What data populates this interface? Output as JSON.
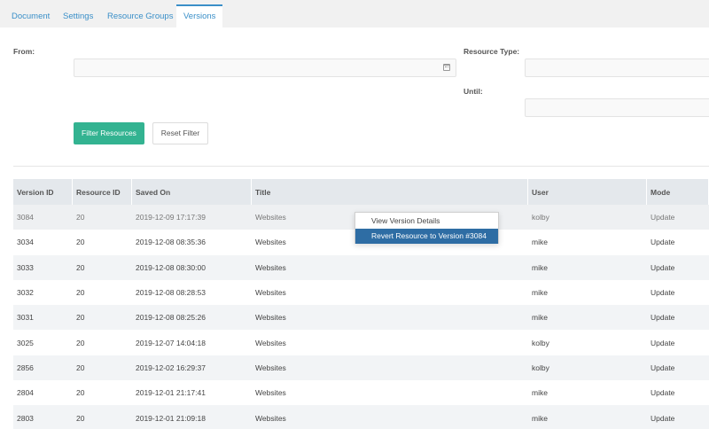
{
  "tabs": [
    {
      "label": "Document"
    },
    {
      "label": "Settings"
    },
    {
      "label": "Resource Groups"
    },
    {
      "label": "Versions"
    }
  ],
  "filter": {
    "from_label": "From:",
    "resource_type_label": "Resource Type:",
    "until_label": "Until:",
    "from_value": "",
    "resource_type_value": "",
    "until_value": "",
    "filter_button": "Filter Resources",
    "reset_button": "Reset Filter"
  },
  "grid": {
    "columns": [
      "Version ID",
      "Resource ID",
      "Saved On",
      "Title",
      "User",
      "Mode"
    ],
    "rows": [
      [
        "3084",
        "20",
        "2019-12-09 17:17:39",
        "Websites",
        "kolby",
        "Update"
      ],
      [
        "3034",
        "20",
        "2019-12-08 08:35:36",
        "Websites",
        "mike",
        "Update"
      ],
      [
        "3033",
        "20",
        "2019-12-08 08:30:00",
        "Websites",
        "mike",
        "Update"
      ],
      [
        "3032",
        "20",
        "2019-12-08 08:28:53",
        "Websites",
        "mike",
        "Update"
      ],
      [
        "3031",
        "20",
        "2019-12-08 08:25:26",
        "Websites",
        "mike",
        "Update"
      ],
      [
        "3025",
        "20",
        "2019-12-07 14:04:18",
        "Websites",
        "kolby",
        "Update"
      ],
      [
        "2856",
        "20",
        "2019-12-02 16:29:37",
        "Websites",
        "kolby",
        "Update"
      ],
      [
        "2804",
        "20",
        "2019-12-01 21:17:41",
        "Websites",
        "mike",
        "Update"
      ],
      [
        "2803",
        "20",
        "2019-12-01 21:09:18",
        "Websites",
        "mike",
        "Update"
      ]
    ]
  },
  "context_menu": {
    "items": [
      {
        "label": "View Version Details"
      },
      {
        "label": "Revert Resource to Version #3084"
      }
    ]
  },
  "colors": {
    "accent": "#3a8fc8",
    "primary_button": "#33b391",
    "menu_highlight": "#2e6da4"
  }
}
